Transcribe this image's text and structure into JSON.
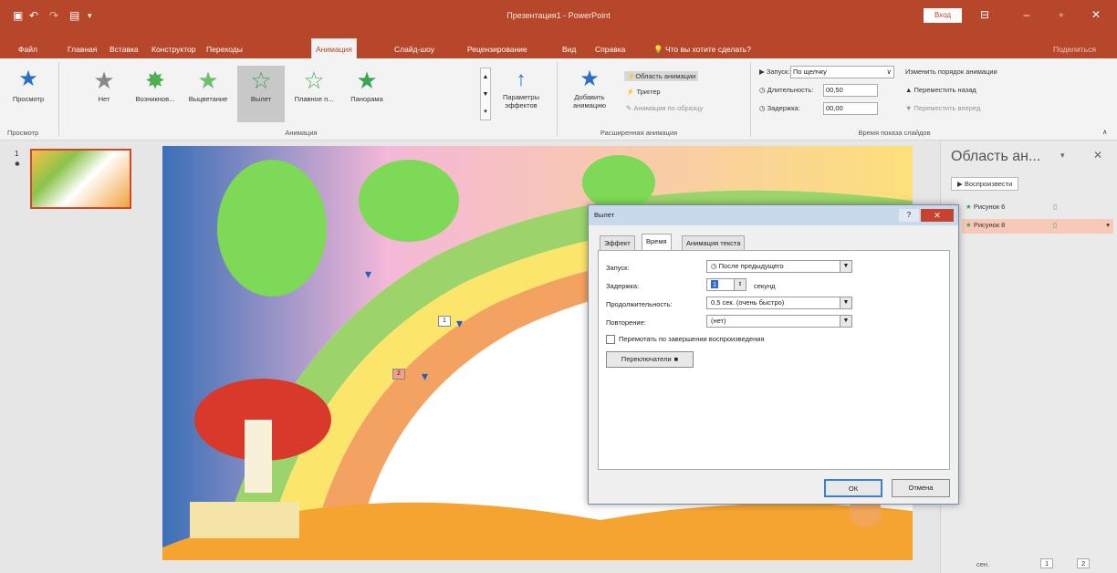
{
  "app": {
    "title": "Презентация1 - PowerPoint",
    "sign_in": "Вход"
  },
  "menu": {
    "tabs": [
      "Файл",
      "Главная",
      "Вставка",
      "Конструктор",
      "Переходы",
      "Анимация",
      "Слайд-шоу",
      "Рецензирование",
      "Вид",
      "Справка"
    ],
    "tell_me": "Что вы хотите сделать?",
    "share": "Поделиться"
  },
  "ribbon": {
    "preview_label": "Просмотр",
    "preview_group": "Просмотр",
    "effects": [
      {
        "label": "Нет",
        "icon": "star-gray-icon"
      },
      {
        "label": "Возникнов...",
        "icon": "star-green-icon"
      },
      {
        "label": "Выцветание",
        "icon": "star-green-icon"
      },
      {
        "label": "Вылет",
        "icon": "star-green-icon"
      },
      {
        "label": "Плавное п...",
        "icon": "star-green-icon"
      },
      {
        "label": "Панорама",
        "icon": "star-green-icon"
      }
    ],
    "effect_options": "Параметры эффектов",
    "animation_group": "Анимация",
    "add_animation": "Добавить анимацию",
    "animation_pane": "Область анимации",
    "trigger": "Триггер",
    "animation_painter": "Анимация по образцу",
    "advanced_group": "Расширенная анимация",
    "start_label": "Запуск:",
    "start_value": "По щелчку",
    "duration_label": "Длительность:",
    "duration_value": "00,50",
    "delay_label": "Задержка:",
    "delay_value": "00,00",
    "reorder_title": "Изменить порядок анимации",
    "move_earlier": "Переместить назад",
    "move_later": "Переместить вперед",
    "timing_group": "Время показа слайдов"
  },
  "slides": {
    "current_number": "1",
    "marker1": "1",
    "marker2": "2"
  },
  "pane": {
    "title": "Область ан...",
    "play_button": "Воспроизвести",
    "items": [
      {
        "label": "Рисунок 6"
      },
      {
        "label": "Рисунок 8"
      }
    ]
  },
  "status": {
    "zoom_label": "сен.",
    "page": "1",
    "total": "2"
  },
  "dialog": {
    "title": "Вылет",
    "tabs": [
      "Эффект",
      "Время",
      "Анимация текста"
    ],
    "start_label": "Запуск:",
    "start_value": "После предыдущего",
    "delay_label": "Задержка:",
    "delay_value": "1",
    "delay_unit": "секунд",
    "duration_label": "Продолжительность:",
    "duration_value": "0,5 сек. (очень быстро)",
    "repeat_label": "Повторение:",
    "repeat_value": "(нет)",
    "rewind_label": "Перемотать по завершении воспроизведения",
    "triggers_button": "Переключатели",
    "ok": "ОК",
    "cancel": "Отмена"
  },
  "colors": {
    "accent": "#b7472a",
    "selected_tab": "#d24726"
  }
}
